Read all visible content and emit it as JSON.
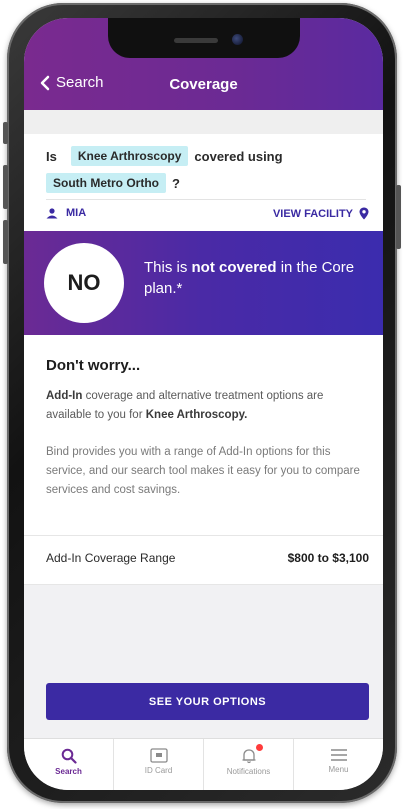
{
  "header": {
    "back_label": "Search",
    "title": "Coverage"
  },
  "question": {
    "prefix": "Is",
    "procedure": "Knee Arthroscopy",
    "middle": "covered using",
    "facility": "South Metro Ortho",
    "suffix": "?"
  },
  "location": {
    "member": "MIA",
    "view_facility_label": "VIEW FACILITY"
  },
  "verdict": {
    "answer": "NO",
    "text_before": "This is ",
    "text_bold": "not covered",
    "text_after": " in the Core plan.*"
  },
  "info": {
    "heading": "Don't worry...",
    "p1_bold_start": "Add-In",
    "p1_middle": " coverage and alternative treatment options are available to you for ",
    "p1_bold_end": "Knee Arthroscopy.",
    "p2": "Bind provides you with a range of Add-In options for this service, and our search tool makes it easy for you to compare services and cost savings."
  },
  "range": {
    "label": "Add-In Coverage Range",
    "value": "$800 to $3,100"
  },
  "cta": {
    "label": "SEE YOUR OPTIONS"
  },
  "tabs": [
    {
      "label": "Search",
      "icon": "search-icon"
    },
    {
      "label": "ID Card",
      "icon": "id-card-icon"
    },
    {
      "label": "Notifications",
      "icon": "bell-icon"
    },
    {
      "label": "Menu",
      "icon": "menu-icon"
    }
  ],
  "colors": {
    "header_purple": "#6b2a94",
    "brand_indigo": "#3b2aa3",
    "chip_cyan": "#c6eef4",
    "notification_red": "#ff3b3b"
  }
}
